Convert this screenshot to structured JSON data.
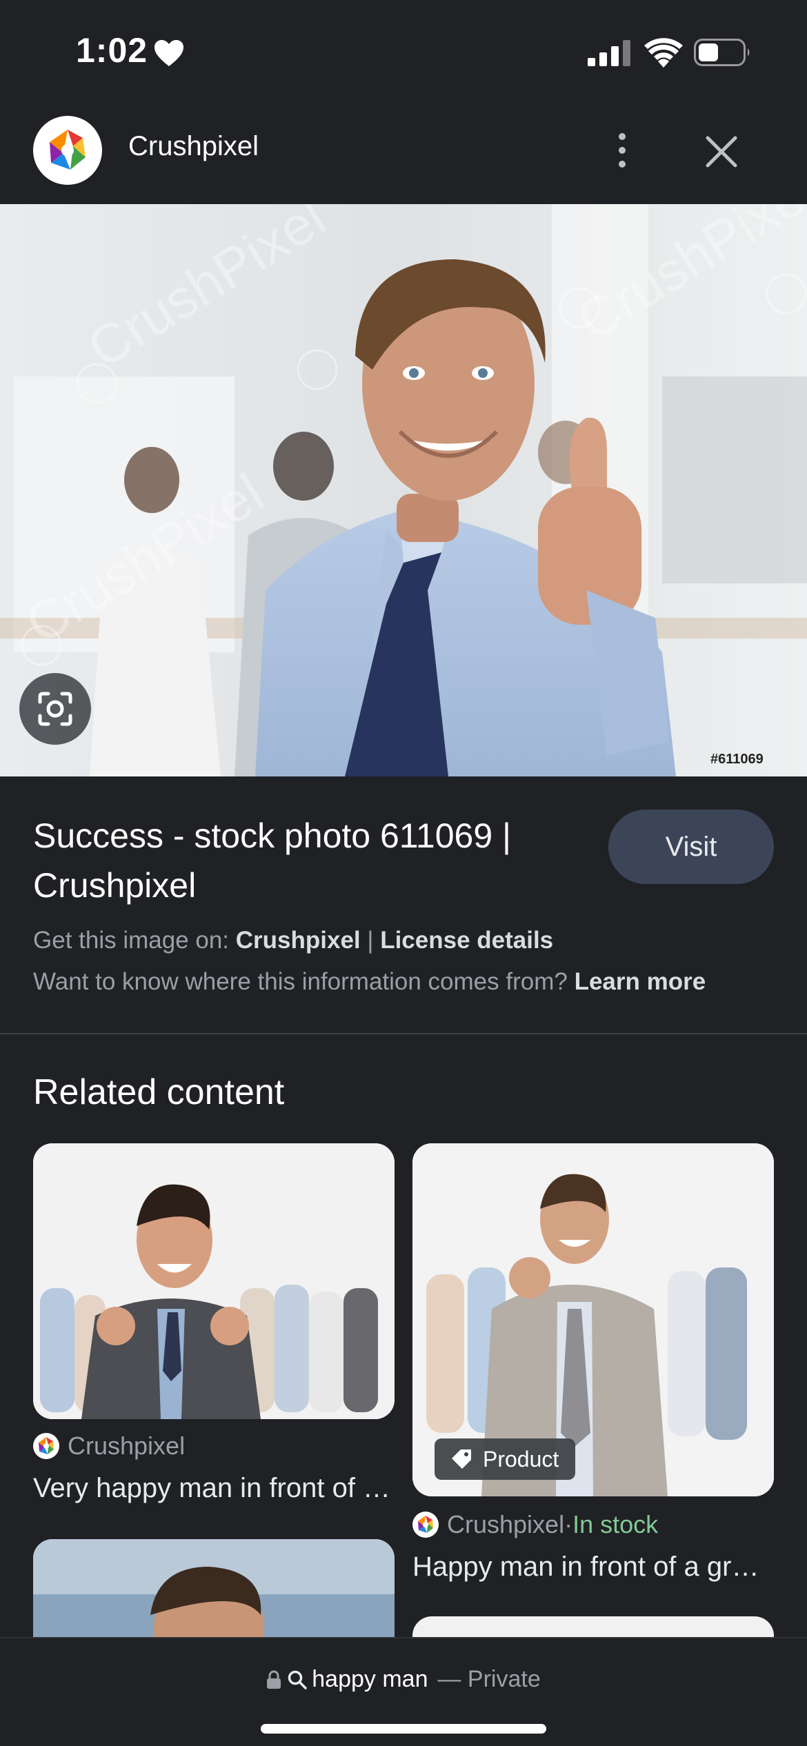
{
  "status_bar": {
    "time": "1:02"
  },
  "header": {
    "site_name": "Crushpixel"
  },
  "hero": {
    "photo_id": "#611069",
    "watermark": "CrushPixel"
  },
  "info": {
    "title": "Success - stock photo 611069 | Crushpixel",
    "visit_label": "Visit",
    "line1_prefix": "Get this image on: ",
    "line1_source": "Crushpixel",
    "line1_sep": " | ",
    "line1_license": "License details",
    "line2_prefix": "Want to know where this information comes from? ",
    "line2_link": "Learn more"
  },
  "related": {
    "title": "Related content",
    "cards": [
      {
        "source": "Crushpixel",
        "caption": "Very happy man in front of a group of business people"
      },
      {
        "source": "Crushpixel",
        "separator": " · ",
        "stock": "In stock",
        "chip": "Product",
        "caption": "Happy man in front of a group of business people"
      }
    ]
  },
  "bottom_bar": {
    "query": "happy man",
    "suffix": "— Private"
  },
  "colors": {
    "background": "#202124",
    "visit_button": "#3c4558",
    "in_stock": "#81c995"
  }
}
